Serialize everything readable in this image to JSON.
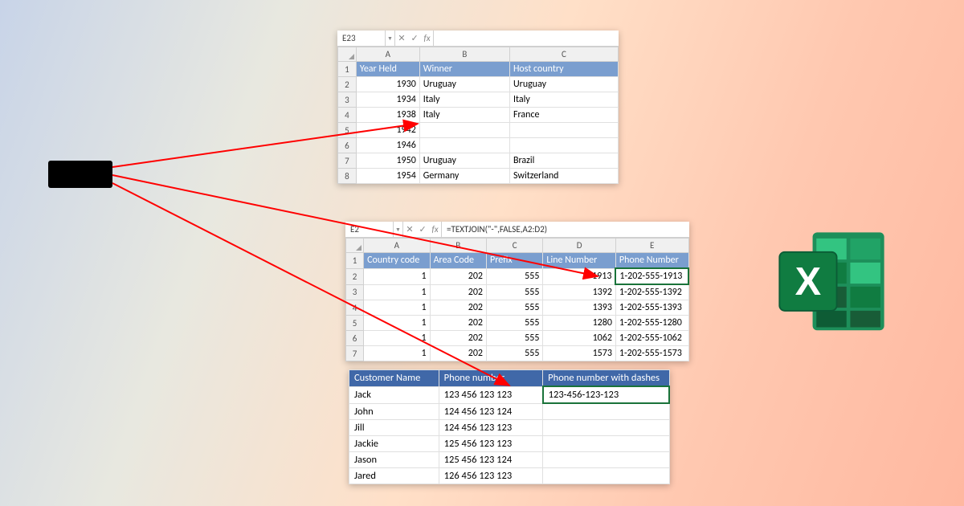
{
  "win1": {
    "name_box": "E23",
    "formula": "",
    "cols": [
      "A",
      "B",
      "C"
    ],
    "header": {
      "a": "Year Held",
      "b": "Winner",
      "c": "Host country"
    },
    "rows": [
      {
        "n": "2",
        "a": "1930",
        "b": "Uruguay",
        "c": "Uruguay"
      },
      {
        "n": "3",
        "a": "1934",
        "b": "Italy",
        "c": "Italy"
      },
      {
        "n": "4",
        "a": "1938",
        "b": "Italy",
        "c": "France"
      },
      {
        "n": "5",
        "a": "1942",
        "b": "",
        "c": ""
      },
      {
        "n": "6",
        "a": "1946",
        "b": "",
        "c": ""
      },
      {
        "n": "7",
        "a": "1950",
        "b": "Uruguay",
        "c": "Brazil"
      },
      {
        "n": "8",
        "a": "1954",
        "b": "Germany",
        "c": "Switzerland"
      }
    ]
  },
  "win2": {
    "name_box": "E2",
    "formula": "=TEXTJOIN(\"-\",FALSE,A2:D2)",
    "cols": [
      "A",
      "B",
      "C",
      "D",
      "E"
    ],
    "header": {
      "a": "Country code",
      "b": "Area Code",
      "c": "Prefix",
      "d": "Line Number",
      "e": "Phone Number"
    },
    "rows": [
      {
        "n": "2",
        "a": "1",
        "b": "202",
        "c": "555",
        "d": "1913",
        "e": "1-202-555-1913"
      },
      {
        "n": "3",
        "a": "1",
        "b": "202",
        "c": "555",
        "d": "1392",
        "e": "1-202-555-1392"
      },
      {
        "n": "4",
        "a": "1",
        "b": "202",
        "c": "555",
        "d": "1393",
        "e": "1-202-555-1393"
      },
      {
        "n": "5",
        "a": "1",
        "b": "202",
        "c": "555",
        "d": "1280",
        "e": "1-202-555-1280"
      },
      {
        "n": "6",
        "a": "1",
        "b": "202",
        "c": "555",
        "d": "1062",
        "e": "1-202-555-1062"
      },
      {
        "n": "7",
        "a": "1",
        "b": "202",
        "c": "555",
        "d": "1573",
        "e": "1-202-555-1573"
      }
    ]
  },
  "win3": {
    "header": {
      "a": "Customer Name",
      "b": "Phone number",
      "c": "Phone number with dashes"
    },
    "rows": [
      {
        "a": "Jack",
        "b": "123 456 123 123",
        "c": "123-456-123-123"
      },
      {
        "a": "John",
        "b": "124 456 123 124",
        "c": ""
      },
      {
        "a": "Jill",
        "b": "124 456 123 123",
        "c": ""
      },
      {
        "a": "Jackie",
        "b": "125 456 123 123",
        "c": ""
      },
      {
        "a": "Jason",
        "b": "125 456 123 124",
        "c": ""
      },
      {
        "a": "Jared",
        "b": "126 456 123 123",
        "c": ""
      }
    ]
  }
}
